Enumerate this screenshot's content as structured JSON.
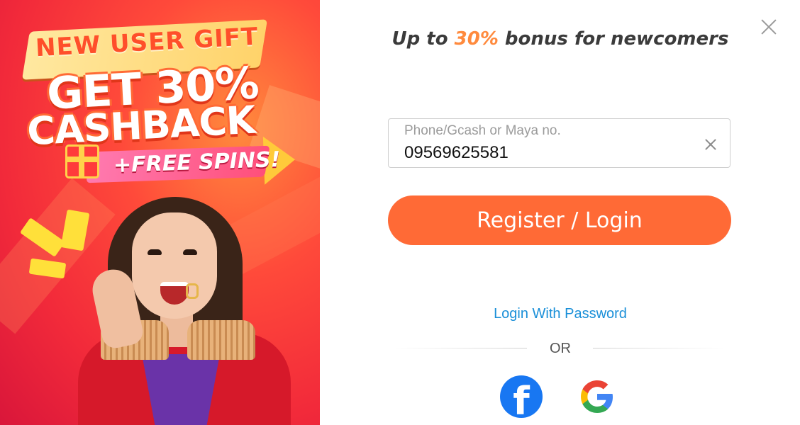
{
  "banner": {
    "line1": "NEW USER GIFT",
    "line2": "GET 30%",
    "line3": "CASHBACK",
    "line4": "+FREE SPINS!"
  },
  "header": {
    "title_prefix": "Up to ",
    "title_accent": "30%",
    "title_suffix": " bonus for newcomers"
  },
  "form": {
    "phone_label": "Phone/Gcash or Maya no.",
    "phone_value": "09569625581",
    "submit_label": "Register / Login",
    "password_link": "Login With Password",
    "or_text": "OR"
  },
  "social": {
    "facebook_glyph": "f",
    "google_glyph": "G"
  },
  "colors": {
    "accent": "#ff6a36",
    "link": "#1a8fd8",
    "facebook": "#1877f2"
  }
}
